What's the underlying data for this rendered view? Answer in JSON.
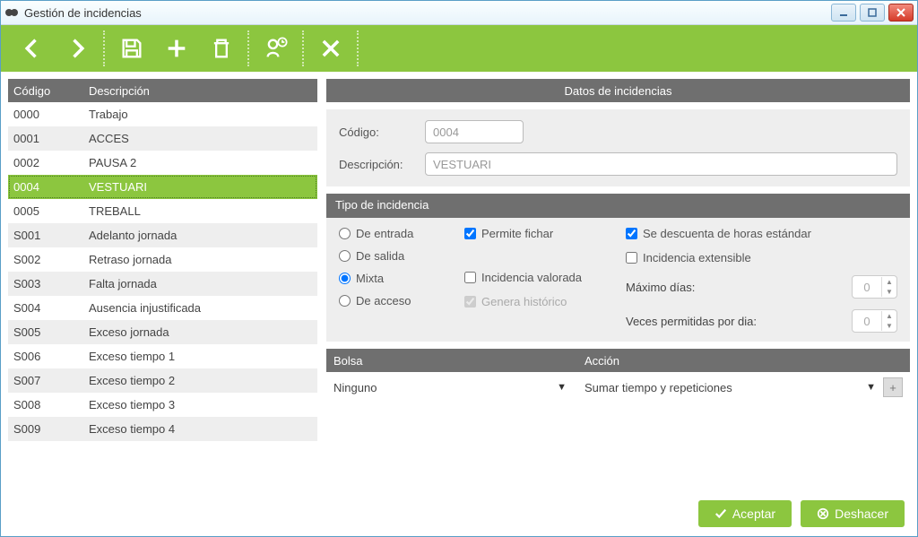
{
  "window": {
    "title": "Gestión de incidencias"
  },
  "list": {
    "headers": {
      "code": "Código",
      "desc": "Descripción"
    },
    "selected_index": 3,
    "items": [
      {
        "code": "0000",
        "desc": "Trabajo"
      },
      {
        "code": "0001",
        "desc": "ACCES"
      },
      {
        "code": "0002",
        "desc": "PAUSA 2"
      },
      {
        "code": "0004",
        "desc": "VESTUARI"
      },
      {
        "code": "0005",
        "desc": "TREBALL"
      },
      {
        "code": "S001",
        "desc": "Adelanto jornada"
      },
      {
        "code": "S002",
        "desc": "Retraso jornada"
      },
      {
        "code": "S003",
        "desc": "Falta jornada"
      },
      {
        "code": "S004",
        "desc": "Ausencia injustificada"
      },
      {
        "code": "S005",
        "desc": "Exceso jornada"
      },
      {
        "code": "S006",
        "desc": "Exceso tiempo 1"
      },
      {
        "code": "S007",
        "desc": "Exceso tiempo 2"
      },
      {
        "code": "S008",
        "desc": "Exceso tiempo 3"
      },
      {
        "code": "S009",
        "desc": "Exceso tiempo 4"
      }
    ]
  },
  "detail": {
    "section_title": "Datos de incidencias",
    "labels": {
      "code": "Código:",
      "desc": "Descripción:"
    },
    "values": {
      "code": "0004",
      "desc": "VESTUARI"
    },
    "tipo": {
      "title": "Tipo de incidencia",
      "options": {
        "entrada": "De entrada",
        "salida": "De salida",
        "mixta": "Mixta",
        "acceso": "De acceso"
      },
      "selected": "mixta"
    },
    "checks": {
      "permite_fichar": {
        "label": "Permite fichar",
        "checked": true
      },
      "incidencia_valorada": {
        "label": "Incidencia valorada",
        "checked": false
      },
      "genera_historico": {
        "label": "Genera histórico",
        "checked": true,
        "disabled": true
      },
      "se_descuenta": {
        "label": "Se descuenta de horas estándar",
        "checked": true
      },
      "extensible": {
        "label": "Incidencia extensible",
        "checked": false
      }
    },
    "max_dias": {
      "label": "Máximo días:",
      "value": "0"
    },
    "veces": {
      "label": "Veces permitidas por dia:",
      "value": "0"
    }
  },
  "bolsa": {
    "headers": {
      "bolsa": "Bolsa",
      "accion": "Acción"
    },
    "row": {
      "bolsa": "Ninguno",
      "accion": "Sumar tiempo y repeticiones"
    }
  },
  "buttons": {
    "accept": "Aceptar",
    "undo": "Deshacer"
  }
}
